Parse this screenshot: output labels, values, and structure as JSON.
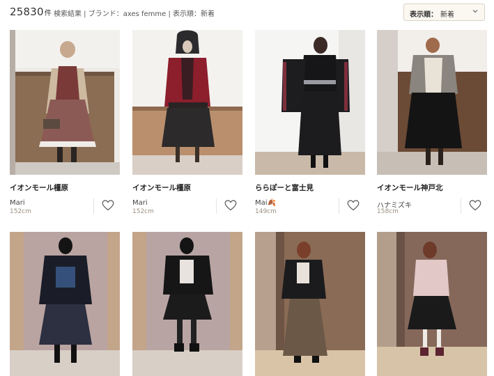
{
  "header": {
    "count": "25830",
    "count_unit": "件",
    "breadcrumb": "検索結果 | ブランド：axes femme | 表示順：新着",
    "sort_label": "表示順：",
    "sort_value": "新着",
    "sort_icon": "chevron-down-icon"
  },
  "cards": [
    {
      "store": "イオンモール橿原",
      "user": "Mari",
      "height": "152cm",
      "fav_icon": "heart-icon"
    },
    {
      "store": "イオンモール橿原",
      "user": "Mari",
      "height": "152cm",
      "fav_icon": "heart-icon"
    },
    {
      "store": "ららぽーと富士見",
      "user": "Mai🍂",
      "height": "149cm",
      "fav_icon": "heart-icon"
    },
    {
      "store": "イオンモール神戸北",
      "user": "ハナミズキ",
      "height": "158cm",
      "fav_icon": "heart-icon"
    },
    {
      "store": "",
      "user": "",
      "height": "",
      "fav_icon": "heart-icon"
    },
    {
      "store": "",
      "user": "",
      "height": "",
      "fav_icon": "heart-icon"
    },
    {
      "store": "",
      "user": "",
      "height": "",
      "fav_icon": "heart-icon"
    },
    {
      "store": "",
      "user": "",
      "height": "",
      "fav_icon": "heart-icon"
    }
  ]
}
